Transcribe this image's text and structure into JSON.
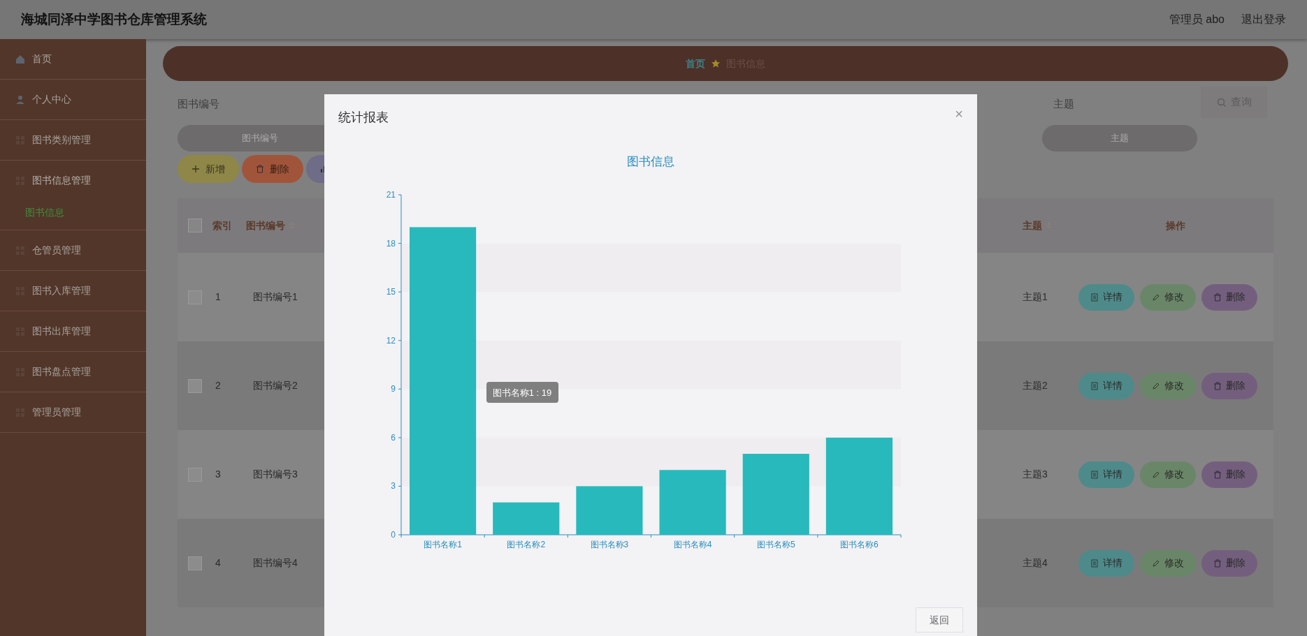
{
  "header": {
    "title": "海城同泽中学图书仓库管理系统",
    "user": "管理员 abo",
    "logout": "退出登录"
  },
  "sidebar": {
    "items": [
      {
        "label": "首页",
        "expanded": false
      },
      {
        "label": "个人中心",
        "expanded": false
      },
      {
        "label": "图书类别管理",
        "expanded": false
      },
      {
        "label": "图书信息管理",
        "expanded": true,
        "children": [
          {
            "label": "图书信息",
            "selected": true
          }
        ]
      },
      {
        "label": "仓管员管理",
        "expanded": false
      },
      {
        "label": "图书入库管理",
        "expanded": false
      },
      {
        "label": "图书出库管理",
        "expanded": false
      },
      {
        "label": "图书盘点管理",
        "expanded": false
      },
      {
        "label": "管理员管理",
        "expanded": false
      }
    ]
  },
  "breadcrumb": [
    "首页",
    "图书信息"
  ],
  "search": {
    "fields": [
      {
        "label": "图书编号",
        "placeholder": "图书编号"
      },
      {
        "label": "主题",
        "placeholder": "主题"
      }
    ],
    "query_button": "查询"
  },
  "toolbar": [
    {
      "kind": "add",
      "label": "新增"
    },
    {
      "kind": "delete",
      "label": "删除"
    },
    {
      "kind": "chart"
    }
  ],
  "table": {
    "select_all": {
      "checked": false
    },
    "columns": [
      "索引",
      "图书编号",
      "主题",
      "操作"
    ],
    "rows": [
      {
        "index": "1",
        "code": "图书编号1",
        "topic": "主题1",
        "checked": false,
        "actions": [
          {
            "kind": "detail",
            "label": "详情"
          },
          {
            "kind": "edit",
            "label": "修改"
          },
          {
            "kind": "delete",
            "label": "删除"
          }
        ]
      },
      {
        "index": "2",
        "code": "图书编号2",
        "topic": "主题2",
        "checked": false,
        "actions": [
          {
            "kind": "detail",
            "label": "详情"
          },
          {
            "kind": "edit",
            "label": "修改"
          },
          {
            "kind": "delete",
            "label": "删除"
          }
        ]
      },
      {
        "index": "3",
        "code": "图书编号3",
        "topic": "主题3",
        "checked": false,
        "actions": [
          {
            "kind": "detail",
            "label": "详情"
          },
          {
            "kind": "edit",
            "label": "修改"
          },
          {
            "kind": "delete",
            "label": "删除"
          }
        ]
      },
      {
        "index": "4",
        "code": "图书编号4",
        "topic": "主题4",
        "checked": false,
        "actions": [
          {
            "kind": "detail",
            "label": "详情"
          },
          {
            "kind": "edit",
            "label": "修改"
          },
          {
            "kind": "delete",
            "label": "删除"
          }
        ]
      }
    ]
  },
  "dialog": {
    "title": "统计报表",
    "close": "×",
    "return_button": "返回",
    "tooltip": "图书名称1 : 19",
    "chart_data": {
      "type": "bar",
      "title": "图书信息",
      "categories": [
        "图书名称1",
        "图书名称2",
        "图书名称3",
        "图书名称4",
        "图书名称5",
        "图书名称6"
      ],
      "series": [
        {
          "color": "#27b9bb",
          "values": [
            19,
            2,
            3,
            4,
            5,
            6
          ]
        }
      ],
      "ylim": [
        0,
        21
      ],
      "yticks": [
        0,
        3,
        6,
        9,
        12,
        15,
        18,
        21
      ]
    }
  }
}
